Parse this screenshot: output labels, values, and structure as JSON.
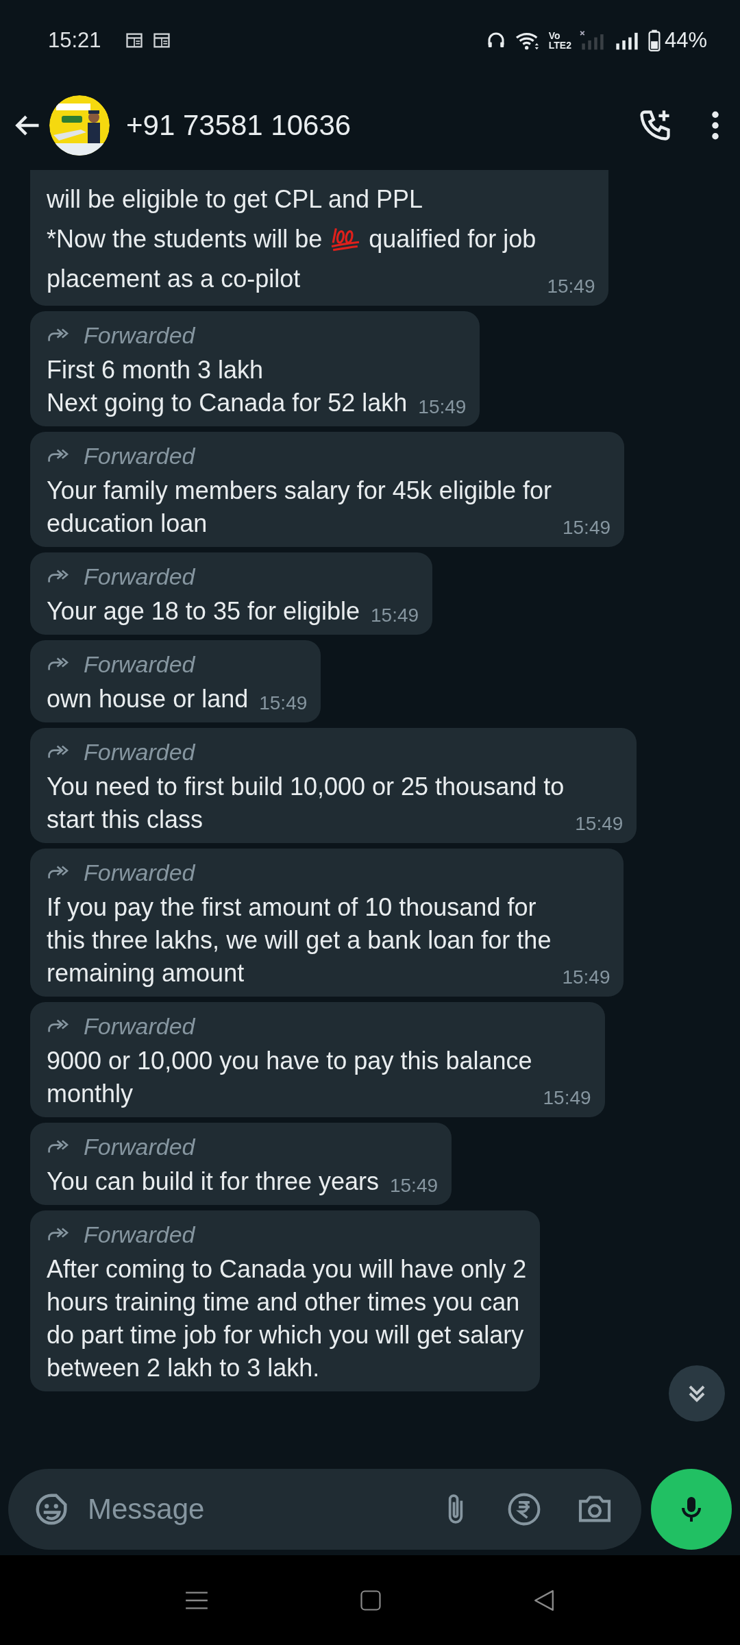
{
  "status_bar": {
    "time": "15:21",
    "network_top": "Vo",
    "network_bottom": "LTE2",
    "battery": "44%"
  },
  "header": {
    "title": "+91 73581 10636"
  },
  "messages": [
    {
      "forwarded": false,
      "parts": [
        {
          "kind": "text",
          "text": "will be eligible to get CPL and PPL\n*Now the students will be "
        },
        {
          "kind": "emoji"
        },
        {
          "kind": "text",
          "text": " qualified for job\nplacement as a co-pilot"
        }
      ],
      "time": "15:49"
    },
    {
      "forwarded": true,
      "forward_label": "Forwarded",
      "parts": [
        {
          "kind": "text",
          "text": "First 6 month 3 lakh\nNext going to Canada for 52 lakh"
        }
      ],
      "time": "15:49"
    },
    {
      "forwarded": true,
      "forward_label": "Forwarded",
      "parts": [
        {
          "kind": "text",
          "text": "Your family members salary for 45k eligible for\neducation loan"
        }
      ],
      "time": "15:49"
    },
    {
      "forwarded": true,
      "forward_label": "Forwarded",
      "parts": [
        {
          "kind": "text",
          "text": "Your age 18 to 35 for eligible"
        }
      ],
      "time": "15:49"
    },
    {
      "forwarded": true,
      "forward_label": "Forwarded",
      "parts": [
        {
          "kind": "text",
          "text": "own house or land"
        }
      ],
      "time": "15:49"
    },
    {
      "forwarded": true,
      "forward_label": "Forwarded",
      "parts": [
        {
          "kind": "text",
          "text": "You need to first build 10,000 or 25 thousand to\nstart this class"
        }
      ],
      "time": "15:49"
    },
    {
      "forwarded": true,
      "forward_label": "Forwarded",
      "parts": [
        {
          "kind": "text",
          "text": "If you pay the first amount of 10 thousand for\nthis three lakhs, we will get a bank loan for the\nremaining amount"
        }
      ],
      "time": "15:49"
    },
    {
      "forwarded": true,
      "forward_label": "Forwarded",
      "parts": [
        {
          "kind": "text",
          "text": "9000 or 10,000 you have to pay this balance\nmonthly"
        }
      ],
      "time": "15:49"
    },
    {
      "forwarded": true,
      "forward_label": "Forwarded",
      "parts": [
        {
          "kind": "text",
          "text": "You can build it for three years"
        }
      ],
      "time": "15:49"
    },
    {
      "forwarded": true,
      "forward_label": "Forwarded",
      "parts": [
        {
          "kind": "text",
          "text": "After coming to Canada you will have only 2\nhours training time and other times you can\ndo part time job for which you will get salary\nbetween 2 lakh to 3 lakh."
        }
      ]
    }
  ],
  "composer": {
    "placeholder": "Message"
  }
}
